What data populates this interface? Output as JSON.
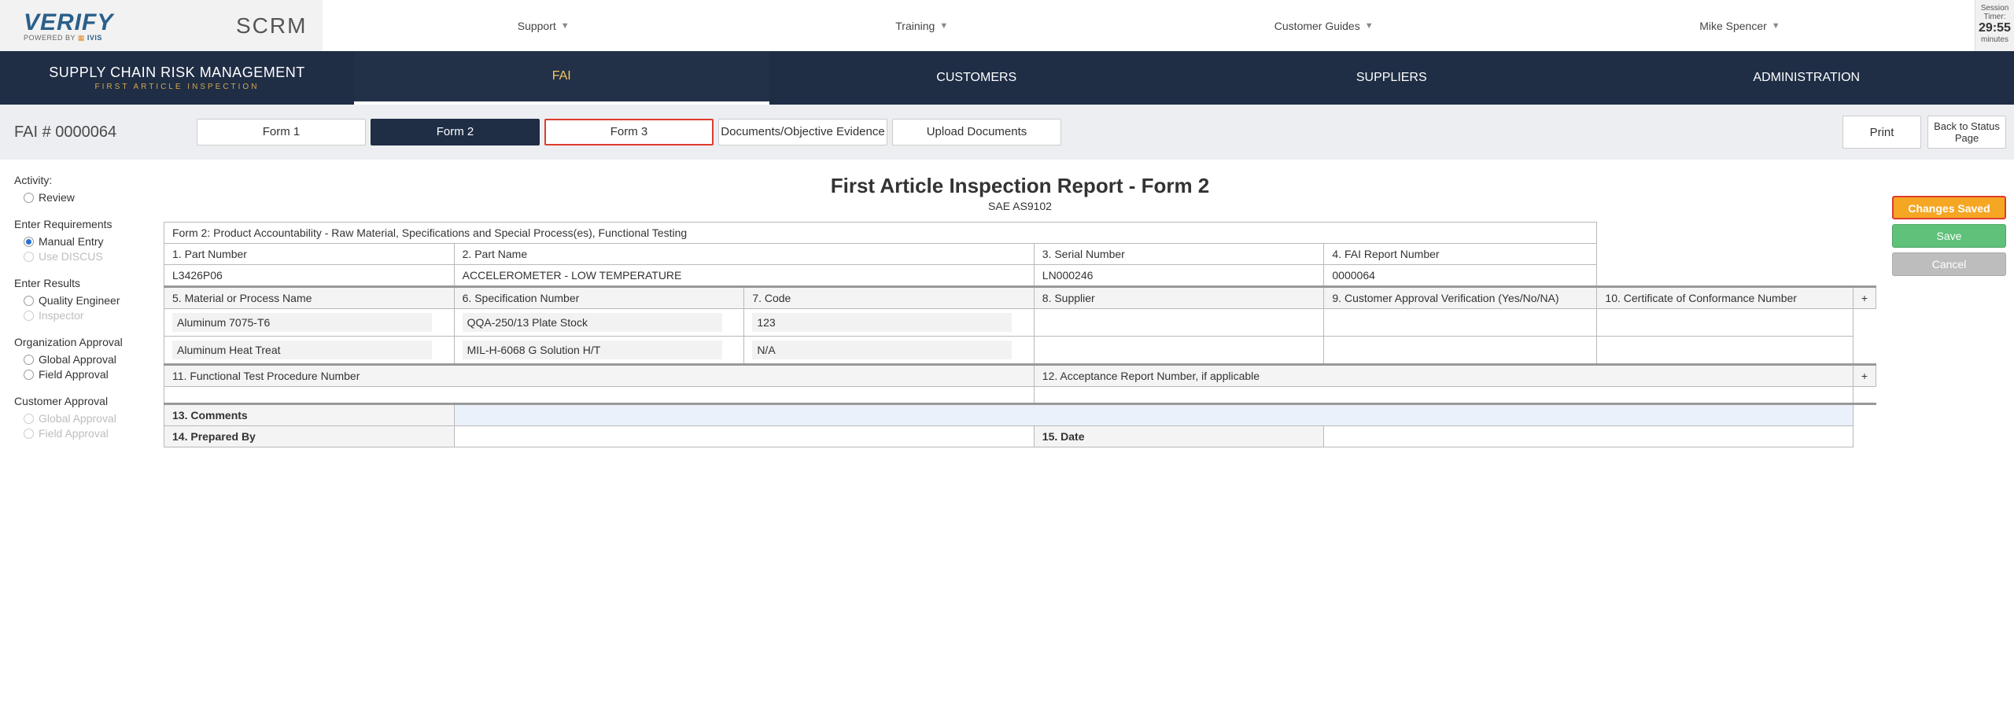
{
  "session": {
    "label": "Session Timer:",
    "time": "29:55",
    "unit": "minutes"
  },
  "topnav": {
    "support": "Support",
    "training": "Training",
    "guides": "Customer Guides",
    "user": "Mike Spencer"
  },
  "brand": {
    "scrm": "SCRM",
    "logo": "VERIFY",
    "powered": "POWERED BY",
    "ivis": "IVIS"
  },
  "darknav": {
    "title": "SUPPLY CHAIN RISK MANAGEMENT",
    "subtitle": "FIRST ARTICLE INSPECTION",
    "tabs": {
      "fai": "FAI",
      "customers": "CUSTOMERS",
      "suppliers": "SUPPLIERS",
      "admin": "ADMINISTRATION"
    }
  },
  "formnav": {
    "fai_id": "FAI # 0000064",
    "form1": "Form 1",
    "form2": "Form 2",
    "form3": "Form 3",
    "docs": "Documents/Objective Evidence",
    "upload": "Upload Documents",
    "print": "Print",
    "back": "Back to Status Page"
  },
  "sidebar": {
    "activity": "Activity:",
    "review": "Review",
    "enter_req": "Enter Requirements",
    "manual": "Manual Entry",
    "discus": "Use DISCUS",
    "enter_res": "Enter Results",
    "qe": "Quality Engineer",
    "insp": "Inspector",
    "org_app": "Organization Approval",
    "ga1": "Global Approval",
    "fa1": "Field Approval",
    "cust_app": "Customer Approval",
    "ga2": "Global Approval",
    "fa2": "Field Approval"
  },
  "form": {
    "title": "First Article Inspection Report - Form 2",
    "subtitle": "SAE AS9102",
    "section": "Form 2: Product Accountability - Raw Material, Specifications and Special Process(es), Functional Testing",
    "h1": "1. Part Number",
    "h2": "2. Part Name",
    "h3": "3. Serial Number",
    "h4": "4. FAI Report Number",
    "v1": "L3426P06",
    "v2": "ACCELEROMETER - LOW TEMPERATURE",
    "v3": "LN000246",
    "v4": "0000064",
    "h5": "5. Material or Process Name",
    "h6": "6. Specification Number",
    "h7": "7. Code",
    "h8": "8. Supplier",
    "h9": "9. Customer Approval Verification (Yes/No/NA)",
    "h10": "10. Certificate of Conformance Number",
    "r1c5": "Aluminum 7075-T6",
    "r1c6": "QQA-250/13 Plate Stock",
    "r1c7": "123",
    "r2c5": "Aluminum Heat Treat",
    "r2c6": "MIL-H-6068 G Solution H/T",
    "r2c7": "N/A",
    "h11": "11. Functional Test Procedure Number",
    "h12": "12. Acceptance Report Number, if applicable",
    "h13": "13. Comments",
    "h14": "14. Prepared By",
    "h15": "15. Date",
    "plus": "+"
  },
  "actions": {
    "changes": "Changes Saved",
    "save": "Save",
    "cancel": "Cancel"
  }
}
